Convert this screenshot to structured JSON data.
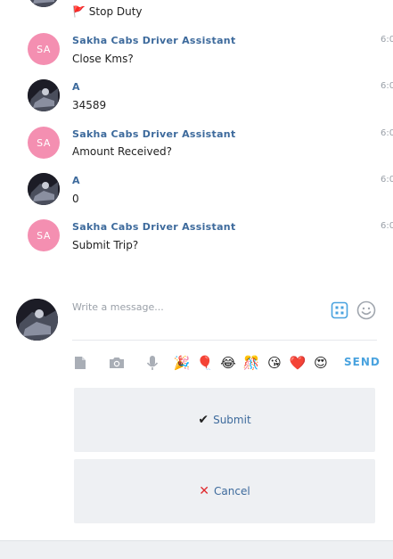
{
  "messages": [
    {
      "sender": "",
      "text": "Stop Duty",
      "text_icon": "🚩",
      "time": "",
      "avatar_type": "photo"
    },
    {
      "sender": "Sakha Cabs Driver Assistant",
      "avatar_initials": "SA",
      "text": "Close Kms?",
      "time": "6:0",
      "avatar_type": "initials"
    },
    {
      "sender": "A",
      "text": "34589",
      "time": "6:0",
      "avatar_type": "photo"
    },
    {
      "sender": "Sakha Cabs Driver Assistant",
      "avatar_initials": "SA",
      "text": "Amount Received?",
      "time": "6:0",
      "avatar_type": "initials"
    },
    {
      "sender": "A",
      "text": "0",
      "time": "6:0",
      "avatar_type": "photo"
    },
    {
      "sender": "Sakha Cabs Driver Assistant",
      "avatar_initials": "SA",
      "text": "Submit Trip?",
      "time": "6:0",
      "avatar_type": "initials"
    }
  ],
  "composer": {
    "placeholder": "Write a message...",
    "send_label": "SEND",
    "apps_icon": "apps-grid-icon",
    "emoji_icon": "smiley-icon",
    "tools": [
      "attach-file-icon",
      "camera-icon",
      "microphone-icon"
    ],
    "quick_emojis": [
      "🎉",
      "🎈",
      "😂",
      "🎊",
      "😘",
      "❤️",
      "😍"
    ]
  },
  "quick_replies": [
    {
      "icon": "✔",
      "label": "Submit"
    },
    {
      "icon": "✕",
      "label": "Cancel"
    }
  ],
  "colors": {
    "sender_name": "#3d6a9c",
    "initials_avatar": "#f48fb1",
    "send_accent": "#4aa3df",
    "reply_bg": "#eef0f3",
    "cancel_red": "#e0292d"
  }
}
